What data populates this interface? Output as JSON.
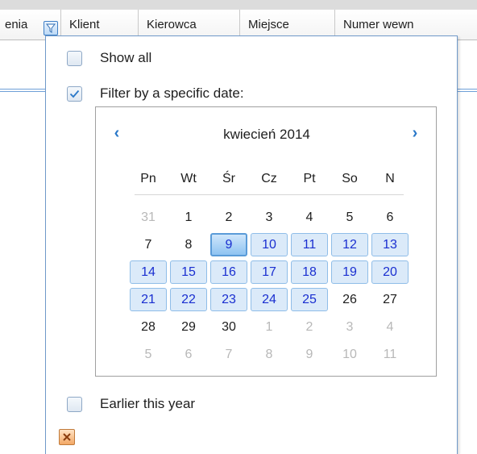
{
  "grid": {
    "columns": [
      "enia",
      "Klient",
      "Kierowca",
      "Miejsce",
      "Numer wewn"
    ]
  },
  "filter_popup": {
    "show_all": {
      "label": "Show all",
      "checked": false
    },
    "specific_date": {
      "label": "Filter by a specific date:",
      "checked": true
    },
    "earlier_this_year": {
      "label": "Earlier this year",
      "checked": false
    },
    "calendar": {
      "month_title": "kwiecień 2014",
      "prev_label": "‹",
      "next_label": "›",
      "weekdays": [
        "Pn",
        "Wt",
        "Śr",
        "Cz",
        "Pt",
        "So",
        "N"
      ],
      "weeks": [
        [
          "31",
          "1",
          "2",
          "3",
          "4",
          "5",
          "6"
        ],
        [
          "7",
          "8",
          "9",
          "10",
          "11",
          "12",
          "13"
        ],
        [
          "14",
          "15",
          "16",
          "17",
          "18",
          "19",
          "20"
        ],
        [
          "21",
          "22",
          "23",
          "24",
          "25",
          "26",
          "27"
        ],
        [
          "28",
          "29",
          "30",
          "1",
          "2",
          "3",
          "4"
        ],
        [
          "5",
          "6",
          "7",
          "8",
          "9",
          "10",
          "11"
        ]
      ],
      "today": "9",
      "selected_range": [
        "9",
        "25"
      ]
    }
  },
  "colors": {
    "accent": "#2a78c8",
    "selected_text": "#1a2fd0",
    "selected_fill": "#dbeaf9",
    "clear_button": "#f3a866"
  },
  "icons": {
    "filter": "funnel-filter-icon",
    "prev": "chevron-left-icon",
    "next": "chevron-right-icon",
    "check": "checkmark-icon",
    "clear": "close-icon"
  }
}
